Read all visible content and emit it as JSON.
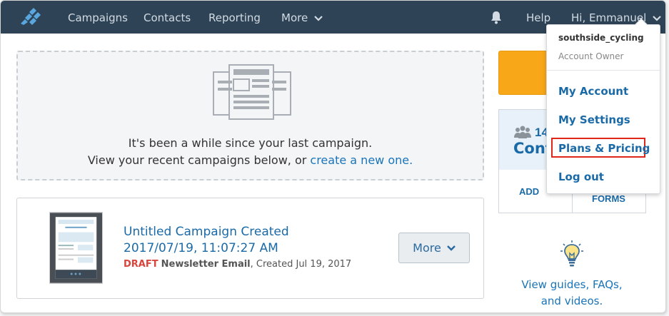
{
  "nav": {
    "items": [
      "Campaigns",
      "Contacts",
      "Reporting",
      "More"
    ],
    "help": "Help",
    "greeting": "Hi, Emmanuel"
  },
  "empty_state": {
    "line1": "It's been a while since your last campaign.",
    "line2_prefix": "View your recent campaigns below, or ",
    "line2_link": "create a new one."
  },
  "campaign": {
    "title": "Untitled Campaign Created 2017/07/19, 11:07:27 AM",
    "status": "DRAFT",
    "type": "Newsletter Email",
    "created": ", Created Jul 19, 2017",
    "more_label": "More"
  },
  "contacts": {
    "count": "14",
    "label": "Cont",
    "add": "ADD",
    "forms": "FORMS"
  },
  "guides": {
    "line1": "View guides, FAQs,",
    "line2": "and videos."
  },
  "dropdown": {
    "username": "southside_cycling",
    "role": "Account Owner",
    "items": [
      "My Account",
      "My Settings",
      "Plans & Pricing",
      "Log out"
    ]
  },
  "colors": {
    "navbar": "#2e4356",
    "link": "#1a6aa8",
    "accent_orange": "#f7a718",
    "draft_red": "#d9453d",
    "highlight_red": "#e0261b"
  },
  "icons": [
    "logo-icon",
    "bell-icon",
    "chevron-down-icon",
    "people-icon",
    "lightbulb-icon"
  ]
}
